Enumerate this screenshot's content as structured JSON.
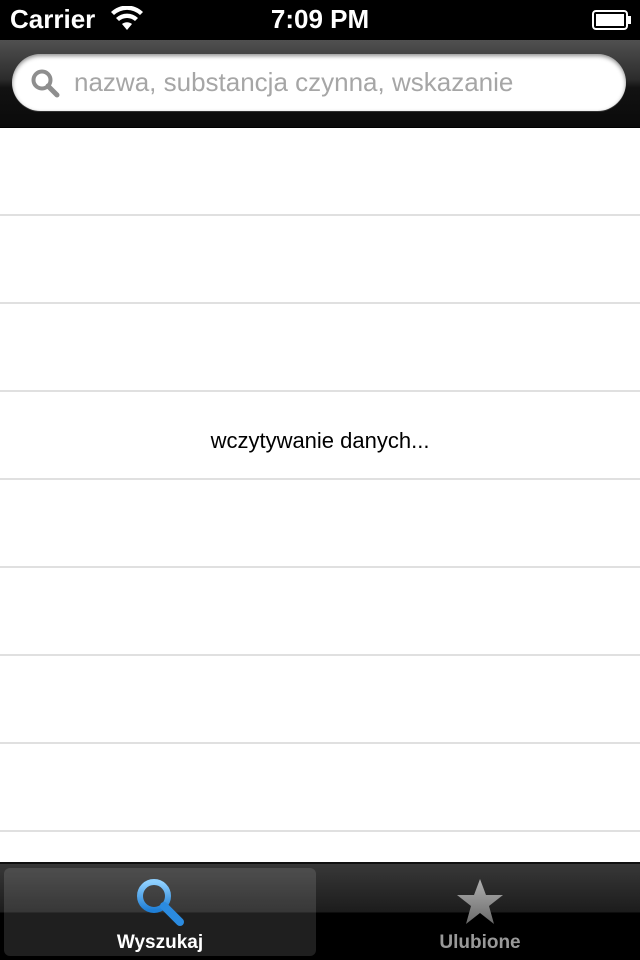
{
  "status_bar": {
    "carrier": "Carrier",
    "time": "7:09 PM"
  },
  "search": {
    "placeholder": "nazwa, substancja czynna, wskazanie",
    "value": ""
  },
  "content": {
    "loading_text": "wczytywanie danych..."
  },
  "tab_bar": {
    "tabs": [
      {
        "label": "Wyszukaj",
        "icon": "search-icon",
        "selected": true,
        "color": "#ffffff"
      },
      {
        "label": "Ulubione",
        "icon": "star-icon",
        "selected": false,
        "color": "#999999"
      }
    ]
  },
  "colors": {
    "accent_blue": "#3a9be6",
    "inactive_gray": "#999999"
  }
}
